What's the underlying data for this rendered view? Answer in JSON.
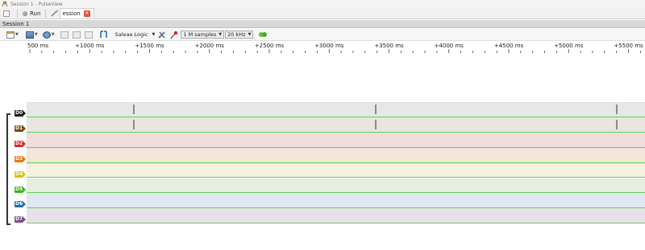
{
  "window": {
    "title": "Session 1 - PulseView"
  },
  "tabs": {
    "run_label": "Run",
    "session_tab_label": "ession"
  },
  "session": {
    "header": "Session 1"
  },
  "toolbar": {
    "device": "Saleae Logic",
    "samples": "1 M samples",
    "rate": "20 kHz"
  },
  "ruler": {
    "ticks": [
      {
        "label": "500 ms"
      },
      {
        "label": "+1000 ms"
      },
      {
        "label": "+1500 ms"
      },
      {
        "label": "+2000 ms"
      },
      {
        "label": "+2500 ms"
      },
      {
        "label": "+3000 ms"
      },
      {
        "label": "+3500 ms"
      },
      {
        "label": "+4000 ms"
      },
      {
        "label": "+4500 ms"
      },
      {
        "label": "+5000 ms"
      },
      {
        "label": "+5500 ms"
      }
    ]
  },
  "channels": [
    {
      "name": "D0",
      "color": "#1a1a1a",
      "lane_bg": "#e7e7e7",
      "edges_ms": [
        1480,
        3500,
        5520
      ]
    },
    {
      "name": "D1",
      "color": "#7a4a12",
      "lane_bg": "#e9e6e0",
      "edges_ms": [
        1480,
        3500,
        5520
      ]
    },
    {
      "name": "D2",
      "color": "#e0252a",
      "lane_bg": "#f3dcdc",
      "edges_ms": []
    },
    {
      "name": "D3",
      "color": "#e8780e",
      "lane_bg": "#f4e7da",
      "edges_ms": []
    },
    {
      "name": "D4",
      "color": "#d6c20b",
      "lane_bg": "#f5f2df",
      "edges_ms": []
    },
    {
      "name": "D5",
      "color": "#3bb51a",
      "lane_bg": "#e4efdd",
      "edges_ms": []
    },
    {
      "name": "D6",
      "color": "#2a6fb5",
      "lane_bg": "#dfe7f0",
      "edges_ms": []
    },
    {
      "name": "D7",
      "color": "#7a4d8c",
      "lane_bg": "#e8e1ea",
      "edges_ms": []
    }
  ]
}
